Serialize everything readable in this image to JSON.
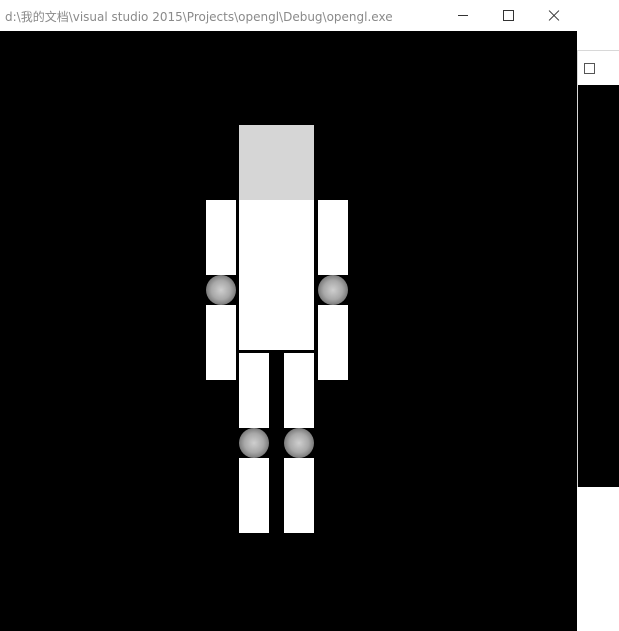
{
  "window": {
    "title": "d:\\我的文档\\visual studio 2015\\Projects\\opengl\\Debug\\opengl.exe",
    "controls": [
      "minimize-icon",
      "maximize-icon",
      "close-icon"
    ]
  },
  "background_window": {
    "controls": [
      "maximize-icon"
    ]
  },
  "scene": {
    "background_color": "#000000",
    "body_color": "#ffffff",
    "head_color": "#d6d6d6",
    "joint_color": "#a8a8a8",
    "parts": [
      "head",
      "torso",
      "upper-arm-left",
      "lower-arm-left",
      "upper-arm-right",
      "lower-arm-right",
      "upper-leg-left",
      "lower-leg-left",
      "upper-leg-right",
      "lower-leg-right"
    ],
    "joints": [
      "elbow-left",
      "elbow-right",
      "knee-left",
      "knee-right"
    ]
  }
}
